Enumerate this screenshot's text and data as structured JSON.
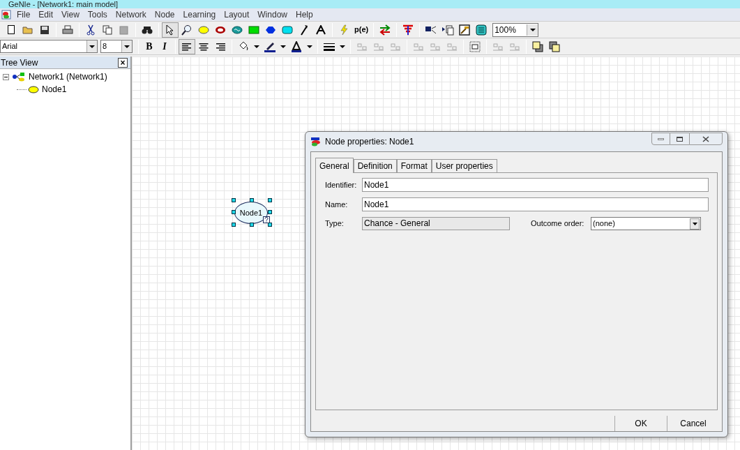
{
  "window": {
    "title": "GeNIe - [Network1: main model]"
  },
  "menu": [
    "File",
    "Edit",
    "View",
    "Tools",
    "Network",
    "Node",
    "Learning",
    "Layout",
    "Window",
    "Help"
  ],
  "toolbar": {
    "tools": [
      {
        "kind": "pointer",
        "selected": true
      },
      {
        "kind": "zoom",
        "selected": false
      },
      {
        "kind": "chance",
        "selected": false
      },
      {
        "kind": "deterministic",
        "selected": false
      },
      {
        "kind": "equation",
        "selected": false
      },
      {
        "kind": "decision",
        "selected": false
      },
      {
        "kind": "utility",
        "selected": false
      },
      {
        "kind": "mau",
        "selected": false
      },
      {
        "kind": "arc",
        "selected": false
      },
      {
        "kind": "text",
        "selected": false
      }
    ],
    "evidence_label": "p(e)",
    "zoom": "100%"
  },
  "format_bar": {
    "font": "Arial",
    "size": "8",
    "bold": "B",
    "italic": "I"
  },
  "tree_view": {
    "title": "Tree View",
    "close": "×",
    "items": [
      {
        "label": "Network1 (Network1)",
        "expanded": true,
        "children": [
          {
            "label": "Node1"
          }
        ]
      }
    ]
  },
  "canvas": {
    "nodes": [
      {
        "label": "Node1",
        "selected": true
      }
    ]
  },
  "dialog": {
    "title": "Node properties: Node1",
    "tabs": [
      {
        "label": "General",
        "selected": true
      },
      {
        "label": "Definition",
        "selected": false
      },
      {
        "label": "Format",
        "selected": false
      },
      {
        "label": "User properties",
        "selected": false
      }
    ],
    "fields": [
      {
        "kind": "text",
        "label": "Identifier:",
        "value": "Node1"
      },
      {
        "kind": "text",
        "label": "Name:",
        "value": "Node1"
      }
    ],
    "type": {
      "label": "Type:",
      "value": "Chance - General"
    },
    "outcome_order": {
      "label": "Outcome order:",
      "value": "(none)"
    },
    "buttons": [
      "OK",
      "Cancel"
    ]
  }
}
